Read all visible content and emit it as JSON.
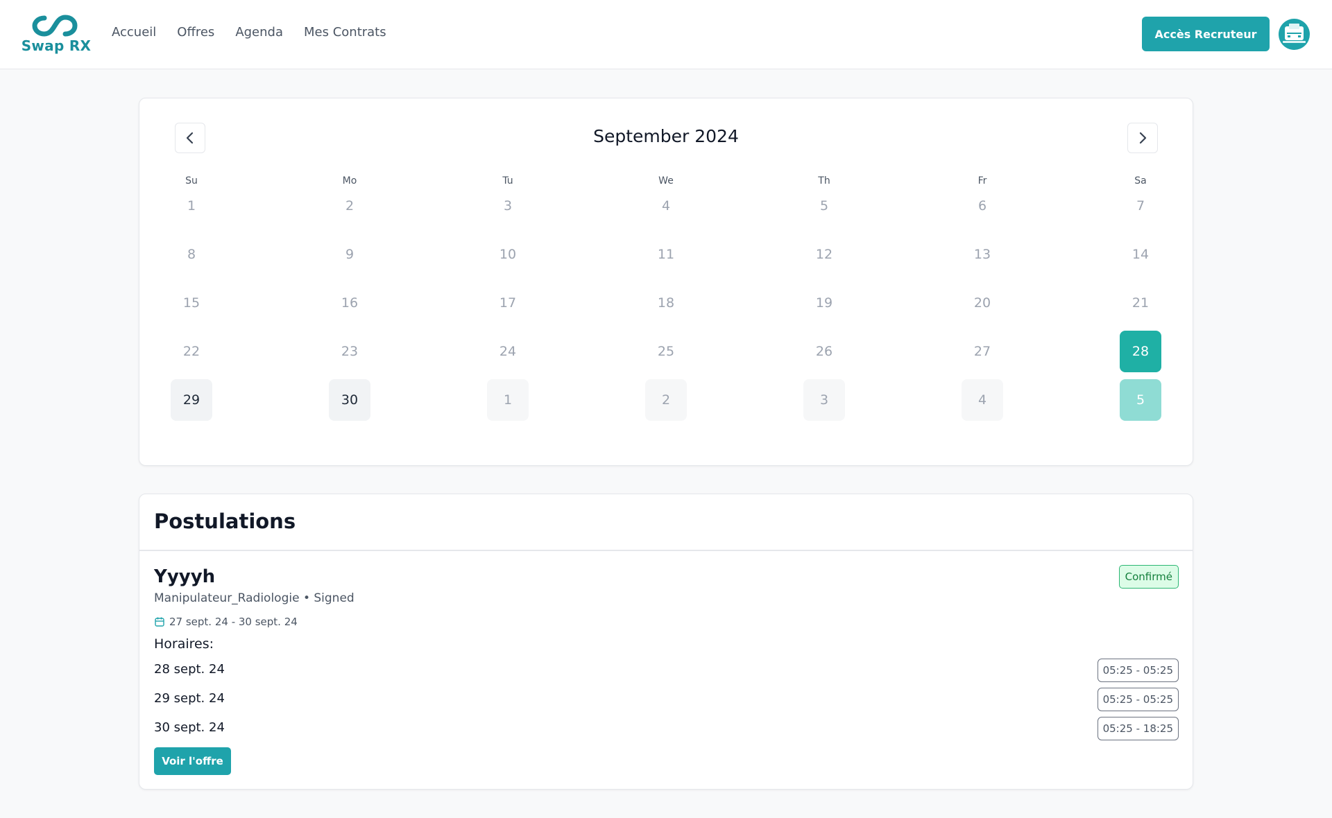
{
  "header": {
    "brand": "Swap RX",
    "nav": [
      {
        "label": "Accueil"
      },
      {
        "label": "Offres"
      },
      {
        "label": "Agenda"
      },
      {
        "label": "Mes Contrats"
      }
    ],
    "recruiter_button": "Accès Recruteur",
    "accent_color": "#1fa3ab"
  },
  "calendar": {
    "title": "September 2024",
    "weekdays": [
      "Su",
      "Mo",
      "Tu",
      "We",
      "Th",
      "Fr",
      "Sa"
    ],
    "weeks": [
      [
        "1",
        "2",
        "3",
        "4",
        "5",
        "6",
        "7"
      ],
      [
        "8",
        "9",
        "10",
        "11",
        "12",
        "13",
        "14"
      ],
      [
        "15",
        "16",
        "17",
        "18",
        "19",
        "20",
        "21"
      ],
      [
        "22",
        "23",
        "24",
        "25",
        "26",
        "27",
        "28"
      ],
      [
        "29",
        "30",
        "1",
        "2",
        "3",
        "4",
        "5"
      ]
    ],
    "selected_days": [
      "28"
    ],
    "highlighted_next_month_days": [
      "5"
    ],
    "prev_icon": "chevron-left-icon",
    "next_icon": "chevron-right-icon",
    "selected_color": "#1fb0a5"
  },
  "postulations": {
    "title": "Postulations",
    "items": [
      {
        "name": "Yyyyh",
        "subtitle": "Manipulateur_Radiologie • Signed",
        "dates": "27 sept. 24 - 30 sept. 24",
        "status": "Confirmé",
        "hours_label": "Horaires:",
        "hours": [
          {
            "date": "28 sept. 24",
            "range": "05:25 - 05:25"
          },
          {
            "date": "29 sept. 24",
            "range": "05:25 - 05:25"
          },
          {
            "date": "30 sept. 24",
            "range": "05:25 - 18:25"
          }
        ],
        "action": "Voir l'offre"
      }
    ]
  }
}
